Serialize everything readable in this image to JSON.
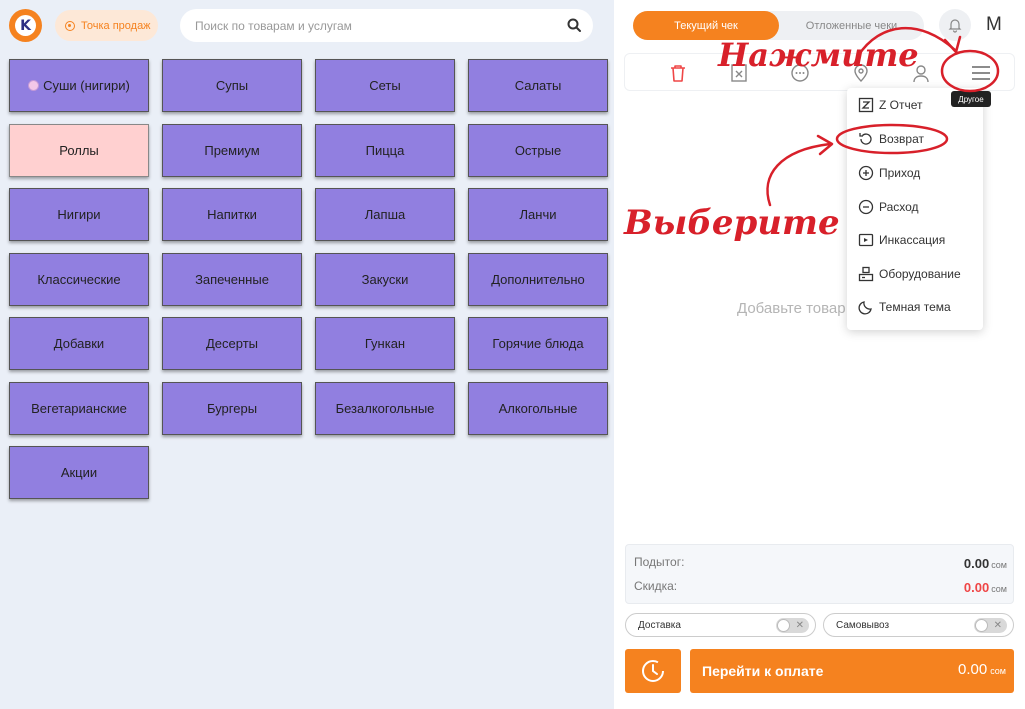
{
  "header": {
    "logo_letter": "K",
    "point_label": "Точка продаж",
    "search_placeholder": "Поиск по товарам и услугам"
  },
  "categories": [
    {
      "label": "Суши (нигири)",
      "active": false,
      "has_icon": true
    },
    {
      "label": "Супы",
      "active": false
    },
    {
      "label": "Сеты",
      "active": false
    },
    {
      "label": "Салаты",
      "active": false
    },
    {
      "label": "Роллы",
      "active": true
    },
    {
      "label": "Премиум",
      "active": false
    },
    {
      "label": "Пицца",
      "active": false
    },
    {
      "label": "Острые",
      "active": false
    },
    {
      "label": "Нигири",
      "active": false
    },
    {
      "label": "Напитки",
      "active": false
    },
    {
      "label": "Лапша",
      "active": false
    },
    {
      "label": "Ланчи",
      "active": false
    },
    {
      "label": "Классические",
      "active": false
    },
    {
      "label": "Запеченные",
      "active": false
    },
    {
      "label": "Закуски",
      "active": false
    },
    {
      "label": "Дополнительно",
      "active": false
    },
    {
      "label": "Добавки",
      "active": false
    },
    {
      "label": "Десерты",
      "active": false
    },
    {
      "label": "Гункан",
      "active": false
    },
    {
      "label": "Горячие блюда",
      "active": false
    },
    {
      "label": "Вегетарианские",
      "active": false
    },
    {
      "label": "Бургеры",
      "active": false
    },
    {
      "label": "Безалкогольные",
      "active": false
    },
    {
      "label": "Алкогольные",
      "active": false
    },
    {
      "label": "Акции",
      "active": false
    }
  ],
  "receipt": {
    "tab_current": "Текущий чек",
    "tab_deferred": "Отложенные чеки",
    "user_letter": "M",
    "empty_text": "Добавьте товар",
    "tooltip": "Другое"
  },
  "menu": {
    "items": [
      {
        "label": "Z Отчет",
        "icon": "z-report-icon"
      },
      {
        "label": "Возврат",
        "icon": "return-icon"
      },
      {
        "label": "Приход",
        "icon": "plus-circle-icon"
      },
      {
        "label": "Расход",
        "icon": "minus-circle-icon"
      },
      {
        "label": "Инкассация",
        "icon": "cash-collection-icon"
      },
      {
        "label": "Оборудование",
        "icon": "equipment-icon"
      },
      {
        "label": "Темная тема",
        "icon": "moon-icon"
      }
    ]
  },
  "summary": {
    "subtotal_label": "Подытог:",
    "subtotal_value": "0.00",
    "discount_label": "Скидка:",
    "discount_value": "0.00",
    "currency": "сом"
  },
  "options": {
    "delivery_label": "Доставка",
    "pickup_label": "Самовывоз"
  },
  "payment": {
    "label": "Перейти к оплате",
    "amount": "0.00",
    "currency": "сом"
  },
  "annotations": {
    "press": "Нажмите",
    "choose": "Выберите"
  },
  "colors": {
    "accent": "#f5821f",
    "category": "#917fe0",
    "category_active": "#ffd0d0",
    "annotation": "#d8202a",
    "discount": "#ef4646"
  }
}
